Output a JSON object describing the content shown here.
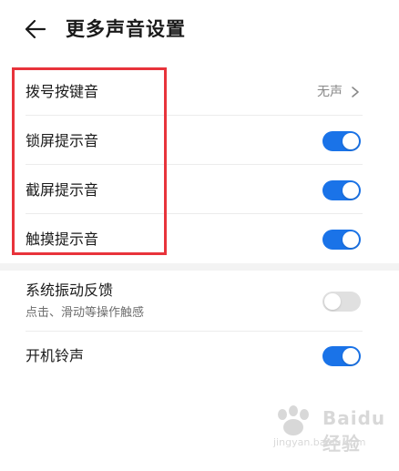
{
  "header": {
    "title": "更多声音设置",
    "back_icon": "arrow-left-icon"
  },
  "settings": [
    {
      "label": "拨号按键音",
      "value": "无声",
      "control": "chevron"
    },
    {
      "label": "锁屏提示音",
      "control": "toggle",
      "state": "on"
    },
    {
      "label": "截屏提示音",
      "control": "toggle",
      "state": "on"
    },
    {
      "label": "触摸提示音",
      "control": "toggle",
      "state": "on"
    }
  ],
  "haptics": {
    "label": "系统振动反馈",
    "subtitle": "点击、滑动等操作触感",
    "state": "off"
  },
  "boot_sound": {
    "label": "开机铃声",
    "state": "on"
  },
  "watermark": {
    "brand": "Baidu 经验",
    "url": "jingyan.baidu.com"
  },
  "colors": {
    "accent": "#1a73e8",
    "highlight": "#e8333b",
    "toggle_off": "#e0e0e0"
  }
}
